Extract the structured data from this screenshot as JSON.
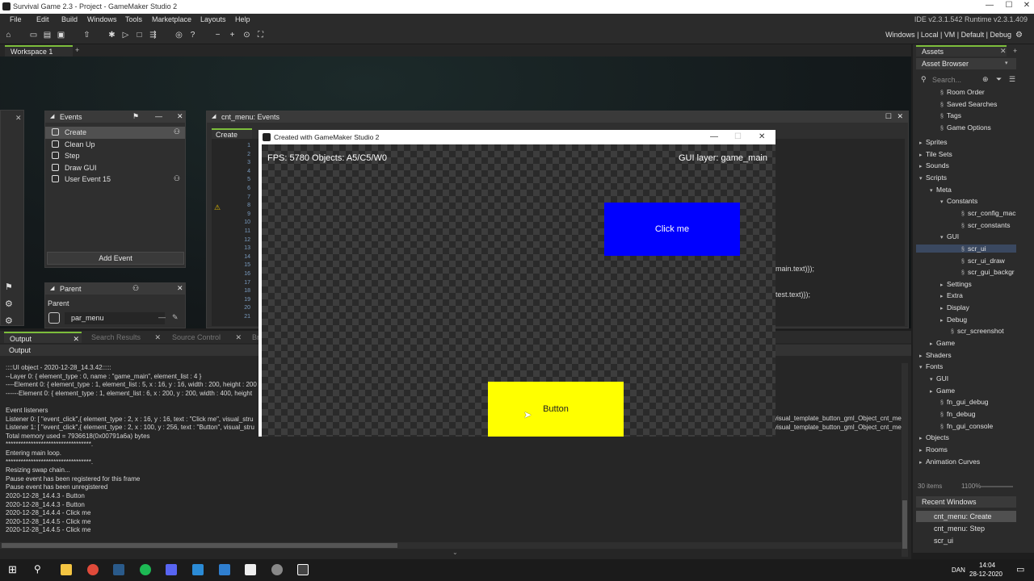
{
  "title_bar": {
    "title": "Survival Game 2.3 - Project - GameMaker Studio 2"
  },
  "menu": {
    "items": [
      "File",
      "Edit",
      "Build",
      "Windows",
      "Tools",
      "Marketplace",
      "Layouts",
      "Help"
    ],
    "version": "IDE v2.3.1.542  Runtime v2.3.1.409"
  },
  "toolbar": {
    "targets": "Windows | Local | VM | Default | Debug"
  },
  "workspace": {
    "tab": "Workspace 1",
    "add": "+"
  },
  "events_panel": {
    "title": "Events",
    "items": [
      "Create",
      "Clean Up",
      "Step",
      "Draw GUI",
      "User Event 15"
    ],
    "add_button": "Add Event"
  },
  "parent_panel": {
    "title": "Parent",
    "label": "Parent",
    "value": "par_menu"
  },
  "code_editor": {
    "title": "cnt_menu: Events",
    "tab": "Create",
    "line_numbers": [
      "1",
      "2",
      "3",
      "4",
      "5",
      "6",
      "7",
      "8",
      "9",
      "10",
      "11",
      "12",
      "13",
      "14",
      "15",
      "16",
      "17",
      "18",
      "19",
      "20",
      "21"
    ],
    "frag1": "main.text)});",
    "frag2": "test.text)});"
  },
  "game_window": {
    "title": "Created with GameMaker Studio 2",
    "fps_text": "FPS: 5780 Objects: A5/C5/W0",
    "gui_layer": "GUI layer: game_main",
    "button_click": "Click me",
    "button_button": "Button",
    "click_color": "#0000ff",
    "button_color": "#ffff00"
  },
  "output": {
    "tabs": [
      "Output",
      "Search Results",
      "Source Control",
      "Br"
    ],
    "header": "Output",
    "lines": [
      "::::UI object - 2020-12-28_14.3.42:::::",
      "--Layer 0: { element_type : 0, name : \"game_main\", element_list : 4 }",
      "----Element 0: { element_type : 1, element_list : 5, x : 16, y : 16, width : 200, height : 200",
      "------Element 0: { element_type : 1, element_list : 6, x : 200, y : 200, width : 400, height",
      "",
      "Event listeners",
      "Listener 0: [ \"event_click\",{ element_type : 2, x : 16, y : 16, text : \"Click me\", visual_stru",
      "Listener 1: [ \"event_click\",{ element_type : 2, x : 100, y : 256, text : \"Button\", visual_stru",
      "Total memory used = 7936618(0x00791a6a) bytes",
      "**********************************.",
      "Entering main loop.",
      "**********************************.",
      "Resizing swap chain...",
      "Pause event has been registered for this frame",
      "Pause event has been unregistered",
      "2020-12-28_14.4.3 - Button",
      "2020-12-28_14.4.3 - Button",
      "2020-12-28_14.4.4 - Click me",
      "2020-12-28_14.4.5 - Click me",
      "2020-12-28_14.4.5 - Click me"
    ],
    "right_frag1": "visual_template_button_gml_Object_cnt_me",
    "right_frag2": "visual_template_button_gml_Object_cnt_me"
  },
  "assets": {
    "header": "Assets",
    "browser": "Asset Browser",
    "search_placeholder": "Search...",
    "tree": [
      {
        "label": "Room Order",
        "indent": 2
      },
      {
        "label": "Saved Searches",
        "indent": 2
      },
      {
        "label": "Tags",
        "indent": 2
      },
      {
        "label": "Game Options",
        "indent": 2
      },
      {
        "label": "Sprites",
        "indent": 0
      },
      {
        "label": "Tile Sets",
        "indent": 0
      },
      {
        "label": "Sounds",
        "indent": 0
      },
      {
        "label": "Scripts",
        "indent": 0
      },
      {
        "label": "Meta",
        "indent": 1
      },
      {
        "label": "Constants",
        "indent": 2
      },
      {
        "label": "scr_config_mac",
        "indent": 4
      },
      {
        "label": "scr_constants",
        "indent": 4
      },
      {
        "label": "GUI",
        "indent": 2
      },
      {
        "label": "scr_ui",
        "indent": 4
      },
      {
        "label": "scr_ui_draw",
        "indent": 4
      },
      {
        "label": "scr_gui_backgr",
        "indent": 4
      },
      {
        "label": "Settings",
        "indent": 2
      },
      {
        "label": "Extra",
        "indent": 2
      },
      {
        "label": "Display",
        "indent": 2
      },
      {
        "label": "Debug",
        "indent": 2
      },
      {
        "label": "scr_screenshot",
        "indent": 3
      },
      {
        "label": "Game",
        "indent": 1
      },
      {
        "label": "Shaders",
        "indent": 0
      },
      {
        "label": "Fonts",
        "indent": 0
      },
      {
        "label": "GUI",
        "indent": 1
      },
      {
        "label": "Game",
        "indent": 1
      },
      {
        "label": "fn_gui_debug",
        "indent": 2
      },
      {
        "label": "fn_debug",
        "indent": 2
      },
      {
        "label": "fn_gui_console",
        "indent": 2
      },
      {
        "label": "Objects",
        "indent": 0
      },
      {
        "label": "Rooms",
        "indent": 0
      },
      {
        "label": "Animation Curves",
        "indent": 0
      }
    ],
    "count": "30 items",
    "zoom": "1100%",
    "recent_header": "Recent Windows",
    "recent": [
      "cnt_menu: Create",
      "cnt_menu: Step",
      "scr_ui"
    ]
  },
  "taskbar": {
    "time": "14:04",
    "date": "28-12-2020",
    "lang": "DAN"
  }
}
